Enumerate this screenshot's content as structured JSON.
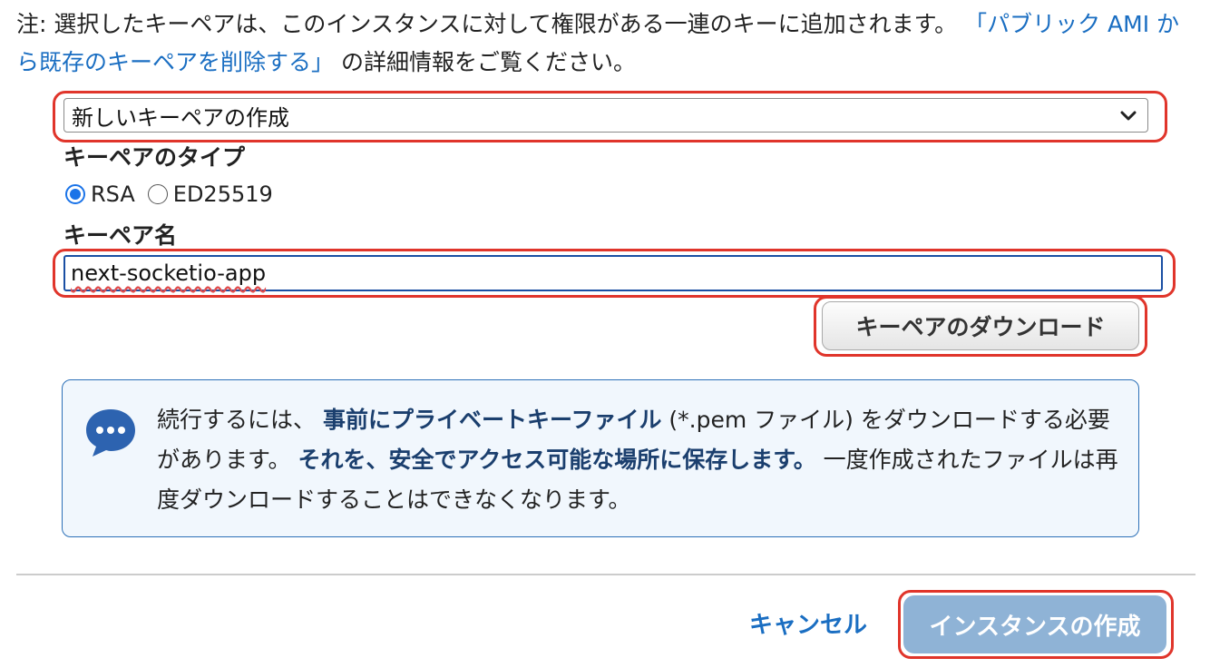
{
  "note": {
    "prefix": "注: 選択したキーペアは、このインスタンスに対して権限がある一連のキーに追加されます。",
    "link": "「パブリック AMI から既存のキーペアを削除する」",
    "suffix": " の詳細情報をご覧ください。"
  },
  "keypair_select": {
    "value": "新しいキーペアの作成"
  },
  "keypair_type": {
    "label": "キーペアのタイプ",
    "options": [
      {
        "label": "RSA",
        "checked": true
      },
      {
        "label": "ED25519",
        "checked": false
      }
    ]
  },
  "keypair_name": {
    "label": "キーペア名",
    "value": "next-socketio-app"
  },
  "download_button": {
    "label": "キーペアのダウンロード"
  },
  "info": {
    "t1": "続行するには、 ",
    "b1": "事前にプライベートキーファイル",
    "t2": " (*.pem ファイル) をダウンロードする必要があります。 ",
    "b2": "それを、安全でアクセス可能な場所に保存します。",
    "t3": " 一度作成されたファイルは再度ダウンロードすることはできなくなります。"
  },
  "footer": {
    "cancel_label": "キャンセル",
    "create_label": "インスタンスの作成"
  },
  "colors": {
    "link": "#1a6ec2",
    "highlight": "#e0352b",
    "info_border": "#2d71b8",
    "primary_disabled": "#8fb3d6"
  },
  "icons": {
    "info": "chat-bubble-icon",
    "select": "chevron-down-icon"
  }
}
